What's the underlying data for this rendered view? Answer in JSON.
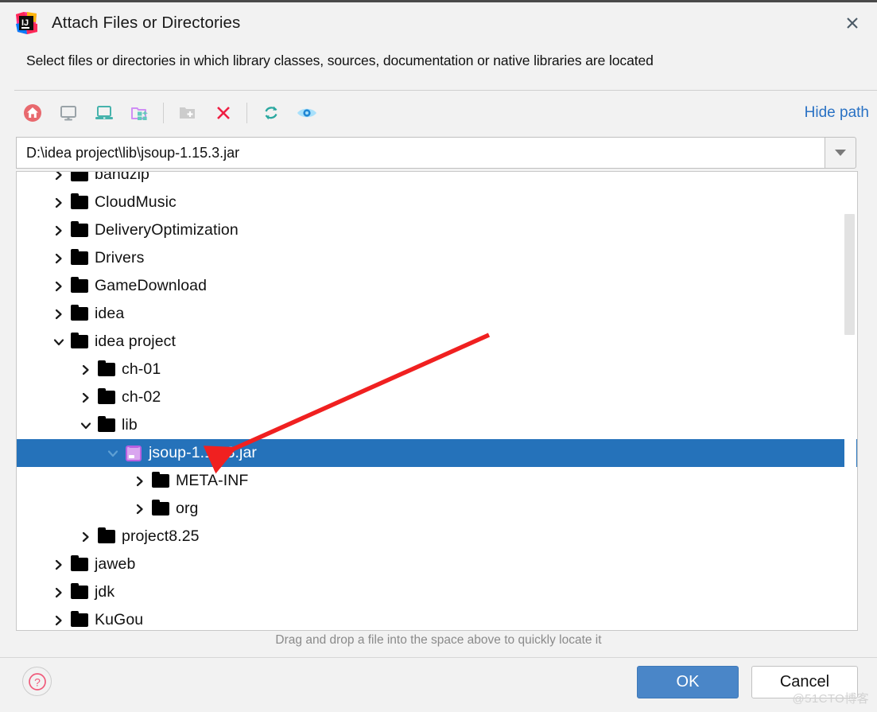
{
  "window": {
    "title": "Attach Files or Directories",
    "app_icon": "intellij-idea-icon",
    "close_icon": "close-icon",
    "description": "Select files or directories in which library classes, sources, documentation or native libraries are located"
  },
  "toolbar": {
    "buttons": [
      {
        "name": "home-icon",
        "tooltip": "Home"
      },
      {
        "name": "desktop-icon",
        "tooltip": "Desktop"
      },
      {
        "name": "laptop-icon",
        "tooltip": "My Computer"
      },
      {
        "name": "project-folder-icon",
        "tooltip": "Project"
      },
      {
        "name": "new-folder-icon",
        "tooltip": "New Folder"
      },
      {
        "name": "delete-icon",
        "tooltip": "Delete"
      },
      {
        "name": "refresh-icon",
        "tooltip": "Refresh"
      },
      {
        "name": "show-hidden-icon",
        "tooltip": "Show Hidden Files"
      }
    ],
    "hide_path_label": "Hide path"
  },
  "path_field": {
    "value": "D:\\idea project\\lib\\jsoup-1.15.3.jar",
    "placeholder": "",
    "dropdown_icon": "chevron-down-icon"
  },
  "tree": {
    "rows": [
      {
        "label": "bandzip",
        "indent": 0,
        "twisty": "collapsed",
        "icon": "folder-icon",
        "selected": false
      },
      {
        "label": "CloudMusic",
        "indent": 0,
        "twisty": "collapsed",
        "icon": "folder-icon",
        "selected": false
      },
      {
        "label": "DeliveryOptimization",
        "indent": 0,
        "twisty": "collapsed",
        "icon": "folder-icon",
        "selected": false
      },
      {
        "label": "Drivers",
        "indent": 0,
        "twisty": "collapsed",
        "icon": "folder-icon",
        "selected": false
      },
      {
        "label": "GameDownload",
        "indent": 0,
        "twisty": "collapsed",
        "icon": "folder-icon",
        "selected": false
      },
      {
        "label": "idea",
        "indent": 0,
        "twisty": "collapsed",
        "icon": "folder-icon",
        "selected": false
      },
      {
        "label": "idea project",
        "indent": 0,
        "twisty": "expanded",
        "icon": "folder-icon",
        "selected": false
      },
      {
        "label": "ch-01",
        "indent": 1,
        "twisty": "collapsed",
        "icon": "folder-icon",
        "selected": false
      },
      {
        "label": "ch-02",
        "indent": 1,
        "twisty": "collapsed",
        "icon": "folder-icon",
        "selected": false
      },
      {
        "label": "lib",
        "indent": 1,
        "twisty": "expanded",
        "icon": "folder-icon",
        "selected": false
      },
      {
        "label": "jsoup-1.15.3.jar",
        "indent": 2,
        "twisty": "expanded",
        "icon": "jar-icon",
        "selected": true
      },
      {
        "label": "META-INF",
        "indent": 3,
        "twisty": "collapsed",
        "icon": "folder-icon",
        "selected": false
      },
      {
        "label": "org",
        "indent": 3,
        "twisty": "collapsed",
        "icon": "folder-icon",
        "selected": false
      },
      {
        "label": "project8.25",
        "indent": 1,
        "twisty": "collapsed",
        "icon": "folder-icon",
        "selected": false
      },
      {
        "label": "jaweb",
        "indent": 0,
        "twisty": "collapsed",
        "icon": "folder-icon",
        "selected": false
      },
      {
        "label": "jdk",
        "indent": 0,
        "twisty": "collapsed",
        "icon": "folder-icon",
        "selected": false
      },
      {
        "label": "KuGou",
        "indent": 0,
        "twisty": "collapsed",
        "icon": "folder-icon",
        "selected": false
      }
    ],
    "selection_color": "#2572ba"
  },
  "footer": {
    "drag_hint": "Drag and drop a file into the space above to quickly locate it",
    "help_icon": "help-icon",
    "ok_label": "OK",
    "cancel_label": "Cancel",
    "ok_color": "#4a86c8"
  },
  "annotation": {
    "arrow_color": "#f02020",
    "arrow_from": "615,418",
    "arrow_to": "265,573"
  },
  "watermark": {
    "text": "@51CTO博客"
  }
}
